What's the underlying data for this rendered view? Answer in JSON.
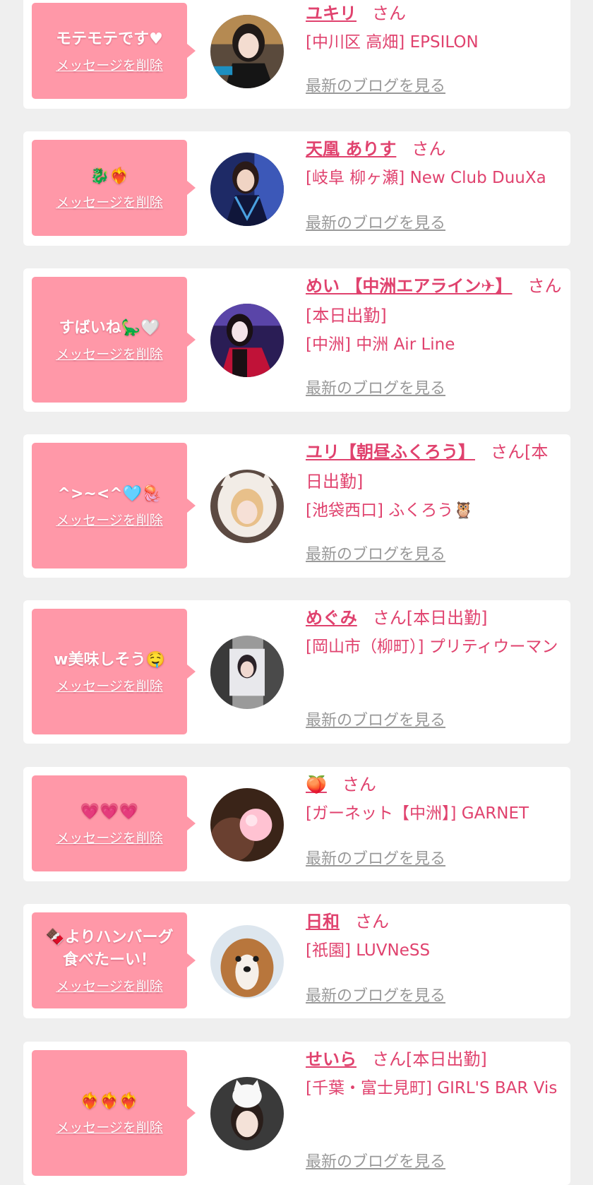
{
  "colors": {
    "background": "#efefef",
    "card": "#ffffff",
    "bubble": "#ff98a8",
    "accent": "#e0426e",
    "link_gray": "#999999"
  },
  "labels": {
    "honorific": "さん",
    "delete_message": "メッセージを削除",
    "view_blog": "最新のブログを見る"
  },
  "messages": [
    {
      "message": "モテモテです♥",
      "name": "ユキリ",
      "suffix": "",
      "shop": "[中川区 高畑] EPSILON"
    },
    {
      "message": "🐉❤️‍🔥",
      "name": "天凰 ありす",
      "suffix": "",
      "shop": "[岐阜 柳ヶ瀬] New Club DuuXa"
    },
    {
      "message": "すばいね🦕🤍",
      "name": "めい 【中洲エアライン✈】",
      "suffix": "[本日出勤]",
      "shop": "[中洲] 中洲 Air Line"
    },
    {
      "message": "^>~<^🩵🪼",
      "name": "ユリ【朝昼ふくろう】",
      "suffix": "[本日出勤]",
      "shop": "[池袋西口] ふくろう🦉"
    },
    {
      "message": "w美味しそう🤤",
      "name": "めぐみ",
      "suffix": "[本日出勤]",
      "shop": "[岡山市（柳町）] プリティウーマン"
    },
    {
      "message": "💗💗💗",
      "name": "🍑",
      "suffix": "",
      "shop": "[ガーネット【中洲】] GARNET"
    },
    {
      "message": "🍫よりハンバーグ食べたーい！",
      "name": "日和",
      "suffix": "",
      "shop": "[祇園] LUVNeSS"
    },
    {
      "message": "❤️‍🔥❤️‍🔥❤️‍🔥",
      "name": "せいら",
      "suffix": "[本日出勤]",
      "shop": "[千葉・富士見町] GIRL'S BAR Vis"
    }
  ]
}
